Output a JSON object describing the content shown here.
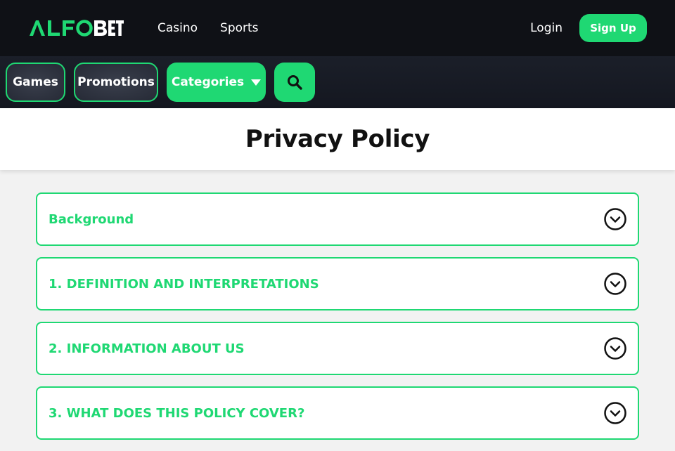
{
  "header": {
    "logo_text": "ALFOBET",
    "nav": [
      "Casino",
      "Sports"
    ],
    "login_label": "Login",
    "signup_label": "Sign Up"
  },
  "subnav": {
    "games_label": "Games",
    "promotions_label": "Promotions",
    "categories_label": "Categories",
    "search_icon": "search-icon"
  },
  "page": {
    "title": "Privacy Policy"
  },
  "accordion": {
    "items": [
      {
        "label": "Background"
      },
      {
        "label": "1. DEFINITION AND INTERPRETATIONS"
      },
      {
        "label": "2. INFORMATION ABOUT US"
      },
      {
        "label": "3. WHAT DOES THIS POLICY COVER?"
      }
    ]
  },
  "colors": {
    "accent": "#1fd873",
    "header_bg": "#0f1116",
    "subnav_bg": "#1b1f29",
    "title_text": "#111111"
  }
}
